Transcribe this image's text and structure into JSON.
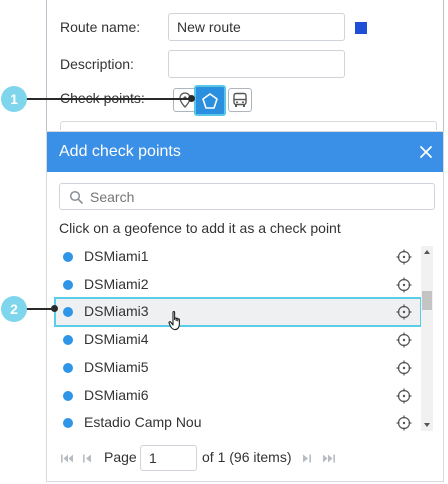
{
  "form": {
    "route_name_label": "Route name:",
    "route_name_value": "New route",
    "description_label": "Description:",
    "description_value": "",
    "checkpoints_label": "Check points:",
    "route_color": "#1e4fd6"
  },
  "checkpoint_buttons": [
    {
      "icon": "map-pin-icon"
    },
    {
      "icon": "geofence-icon",
      "active": true
    },
    {
      "icon": "bus-icon"
    }
  ],
  "dialog": {
    "title": "Add check points",
    "search_placeholder": "Search",
    "hint": "Click on a geofence to add it as a check point",
    "items": [
      {
        "label": "DSMiami1",
        "color": "#2f95e6"
      },
      {
        "label": "DSMiami2",
        "color": "#2f95e6"
      },
      {
        "label": "DSMiami3",
        "color": "#2f95e6",
        "hovered": true
      },
      {
        "label": "DSMiami4",
        "color": "#2f95e6"
      },
      {
        "label": "DSMiami5",
        "color": "#2f95e6"
      },
      {
        "label": "DSMiami6",
        "color": "#2f95e6"
      },
      {
        "label": "Estadio Camp Nou",
        "color": "#2f95e6"
      }
    ],
    "pager": {
      "page_label": "Page",
      "page_value": "1",
      "of_label": "of 1 (96 items)"
    }
  },
  "callouts": [
    {
      "number": "1"
    },
    {
      "number": "2"
    }
  ],
  "colors": {
    "header": "#3a8fe6",
    "callout": "#7fd6ec",
    "highlight_border": "#5bcde6"
  }
}
